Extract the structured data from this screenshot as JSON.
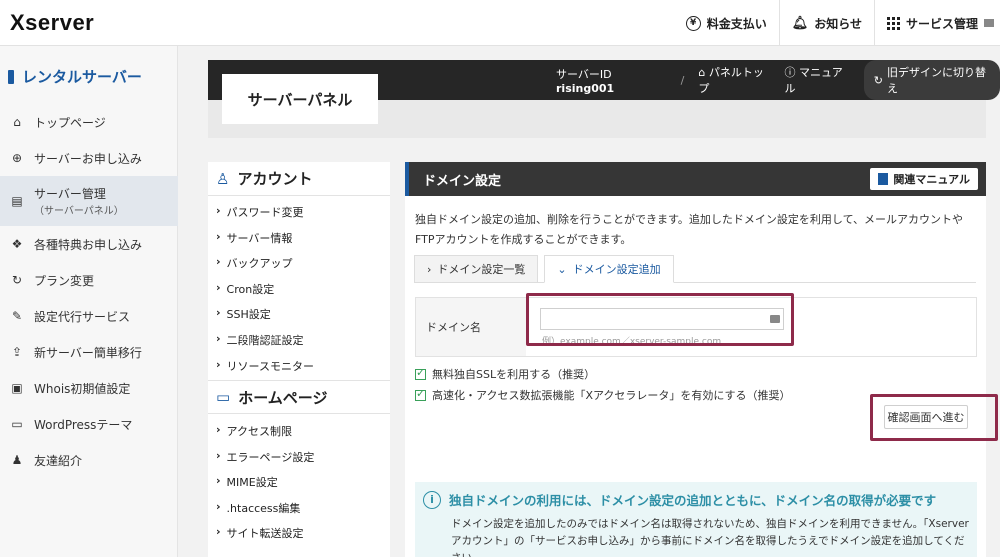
{
  "header": {
    "logo": "Xserver",
    "nav": [
      {
        "icon": "yen-icon",
        "label": "料金支払い"
      },
      {
        "icon": "bell-icon",
        "label": "お知らせ"
      },
      {
        "icon": "grid-icon",
        "label": "サービス管理"
      }
    ]
  },
  "sidebar": {
    "title": "レンタルサーバー",
    "items": [
      {
        "icon": "home-icon",
        "label": "トップページ",
        "sub": ""
      },
      {
        "icon": "plus-circle-icon",
        "label": "サーバーお申し込み",
        "sub": ""
      },
      {
        "icon": "server-icon",
        "label": "サーバー管理",
        "sub": "（サーバーパネル）"
      },
      {
        "icon": "gift-icon",
        "label": "各種特典お申し込み",
        "sub": ""
      },
      {
        "icon": "refresh-icon",
        "label": "プラン変更",
        "sub": ""
      },
      {
        "icon": "wrench-icon",
        "label": "設定代行サービス",
        "sub": ""
      },
      {
        "icon": "upload-icon",
        "label": "新サーバー簡単移行",
        "sub": ""
      },
      {
        "icon": "whois-icon",
        "label": "Whois初期値設定",
        "sub": ""
      },
      {
        "icon": "window-icon",
        "label": "WordPressテーマ",
        "sub": ""
      },
      {
        "icon": "user-icon",
        "label": "友達紹介",
        "sub": ""
      }
    ]
  },
  "panel": {
    "title": "サーバーパネル",
    "server_id_label": "サーバーID",
    "server_id": "rising001",
    "separator": "/",
    "top_link": "パネルトップ",
    "manual_link": "マニュアル",
    "old_design": "旧デザインに切り替え"
  },
  "menu": {
    "account_title": "アカウント",
    "account_links": [
      "パスワード変更",
      "サーバー情報",
      "バックアップ",
      "Cron設定",
      "SSH設定",
      "二段階認証設定",
      "リソースモニター"
    ],
    "homepage_title": "ホームページ",
    "homepage_links": [
      "アクセス制限",
      "エラーページ設定",
      "MIME設定",
      ".htaccess編集",
      "サイト転送設定"
    ]
  },
  "main": {
    "title": "ドメイン設定",
    "manual_button": "関連マニュアル",
    "description": "独自ドメイン設定の追加、削除を行うことができます。追加したドメイン設定を利用して、メールアカウントやFTPアカウントを作成することができます。",
    "tabs": [
      {
        "label": "ドメイン設定一覧",
        "active": false
      },
      {
        "label": "ドメイン設定追加",
        "active": true
      }
    ],
    "domain_label": "ドメイン名",
    "domain_value": "",
    "domain_placeholder": "",
    "domain_hint": "例）example.com／xserver-sample.com",
    "ssl_check": "無料独自SSLを利用する（推奨）",
    "accel_check": "高速化・アクセス数拡張機能「Xアクセラレータ」を有効にする（推奨）",
    "confirm_button": "確認画面へ進む",
    "info_title": "独自ドメインの利用には、ドメイン設定の追加とともに、ドメイン名の取得が必要です",
    "info_text": "ドメイン設定を追加したのみではドメイン名は取得されないため、独自ドメインを利用できません。「Xserverアカウント」の「サービスお申し込み」から事前にドメイン名を取得したうえでドメイン設定を追加してください。"
  },
  "colors": {
    "accent": "#1b5aa0",
    "highlight": "#8e2a4a",
    "check": "#3aa05a",
    "info": "#2d8fa6"
  }
}
